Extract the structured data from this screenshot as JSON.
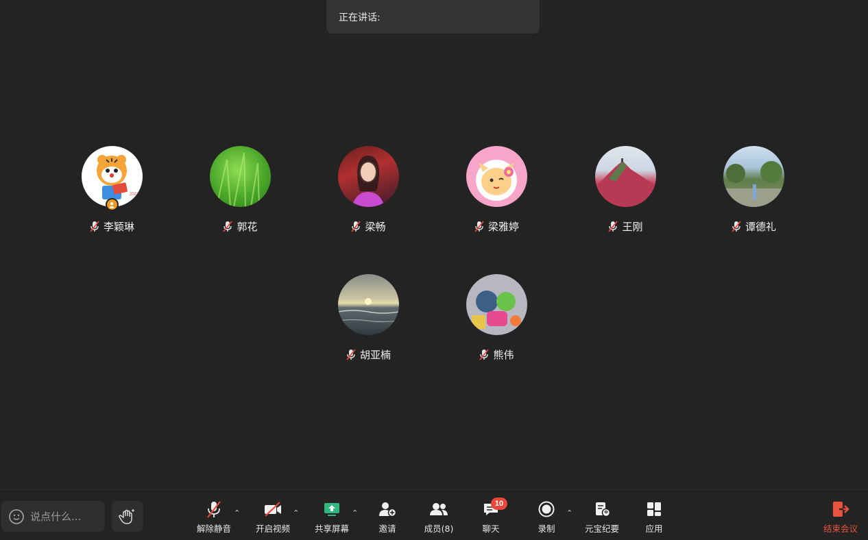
{
  "speaking_banner": {
    "label": "正在讲话:"
  },
  "participants": [
    {
      "name": "李颖琳",
      "host": true
    },
    {
      "name": "郭花"
    },
    {
      "name": "梁畅"
    },
    {
      "name": "梁雅婷"
    },
    {
      "name": "王刚"
    },
    {
      "name": "谭德礼"
    },
    {
      "name": "胡亚楠"
    },
    {
      "name": "熊伟"
    }
  ],
  "toolbar": {
    "chat_placeholder": "说点什么...",
    "unmute": "解除静音",
    "start_video": "开启视频",
    "share_screen": "共享屏幕",
    "invite": "邀请",
    "members": "成员(8)",
    "chat": "聊天",
    "chat_badge": "10",
    "record": "录制",
    "yuanbao_minutes": "元宝纪要",
    "apps": "应用",
    "end_meeting": "结束会议"
  },
  "colors": {
    "background": "#232323",
    "end_meeting": "#e8533f",
    "badge": "#e9473a",
    "share_screen_icon": "#2fb77f",
    "host_badge": "#f29a1f"
  }
}
